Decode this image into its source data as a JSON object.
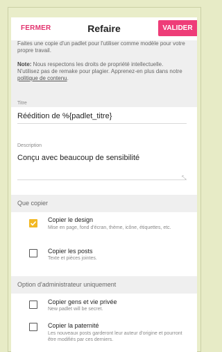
{
  "header": {
    "close_label": "FERMER",
    "title": "Refaire",
    "submit_label": "VALIDER"
  },
  "info": {
    "line1": "Faites une copie d'un padlet pour l'utiliser comme modèle pour votre propre travail.",
    "note_label": "Note:",
    "line2": " Nous respectons les droits de propriété intellectuelle.",
    "line3": "N'utilisez pas de remake pour plagier. Apprenez-en plus dans notre ",
    "link": "politique de contenu",
    "line3_end": "."
  },
  "fields": {
    "title_label": "Titre",
    "title_value": "Réédition de  %{padlet_titre}",
    "description_label": "Description",
    "description_value": "Conçu avec beaucoup de sensibilité"
  },
  "copy_section": {
    "heading": "Que copier",
    "options": [
      {
        "title": "Copier le design",
        "sub": "Mise en page, fond d'écran, thème, icône, étiquettes, etc.",
        "checked": true
      },
      {
        "title": "Copier les posts",
        "sub": "Texte et pièces jointes.",
        "checked": false
      }
    ]
  },
  "admin_section": {
    "heading": "Option d'administrateur uniquement",
    "options": [
      {
        "title": "Copier gens et vie privée",
        "sub": "New padlet will be secret.",
        "checked": false
      },
      {
        "title": "Copier la paternité",
        "sub": "Les nouveaux posts garderont leur auteur d'origine et pourront être modifiés par ces derniers.",
        "checked": false
      }
    ]
  },
  "colors": {
    "accent": "#ee3d78",
    "checkbox_checked": "#f2b824",
    "background": "#e7ebc6"
  }
}
